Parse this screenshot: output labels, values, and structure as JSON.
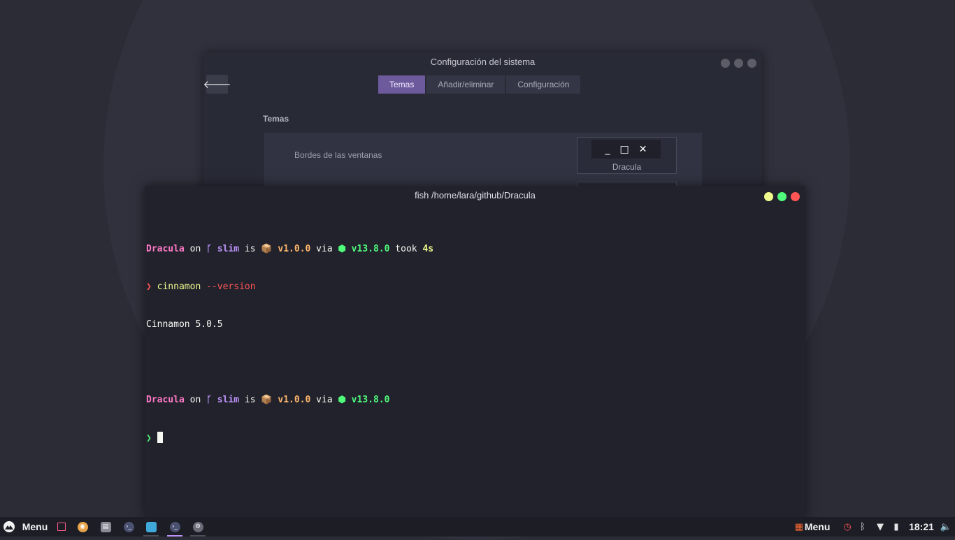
{
  "settings": {
    "title": "Configuración del sistema",
    "tabs": [
      {
        "label": "Temas",
        "active": true
      },
      {
        "label": "Añadir/eliminar",
        "active": false
      },
      {
        "label": "Configuración",
        "active": false
      }
    ],
    "section_title": "Temas",
    "row_label": "Bordes de las ventanas",
    "theme_name": "Dracula",
    "back_icon": "arrow-left-icon"
  },
  "terminal": {
    "title": "fish /home/lara/github/Dracula",
    "lines": {
      "p1": {
        "dir": "Dracula",
        "on": " on ",
        "branch_icon": "ᚴ",
        "branch": " slim",
        "is": " is ",
        "pkg_icon": "📦",
        "version": " v1.0.0",
        "via": " via ",
        "node_icon": "⬢",
        "node_version": " v13.8.0",
        "took": " took ",
        "duration": "4s"
      },
      "cmd1": {
        "prompt": "❯",
        "command": " cinnamon",
        "args": " --version"
      },
      "out1": "Cinnamon 5.0.5",
      "p2": {
        "dir": "Dracula",
        "on": " on ",
        "branch_icon": "ᚴ",
        "branch": " slim",
        "is": " is ",
        "pkg_icon": "📦",
        "version": " v1.0.0",
        "via": " via ",
        "node_icon": "⬢",
        "node_version": " v13.8.0"
      },
      "cmd2": {
        "prompt": "❯ "
      }
    }
  },
  "panel": {
    "menu_label": "Menu",
    "right_menu_label": "Menu",
    "clock": "18:21"
  },
  "colors": {
    "accent": "#6d5a9c",
    "close": "#ff5555",
    "maximize": "#50fa7b",
    "minimize": "#f1fa8c"
  }
}
